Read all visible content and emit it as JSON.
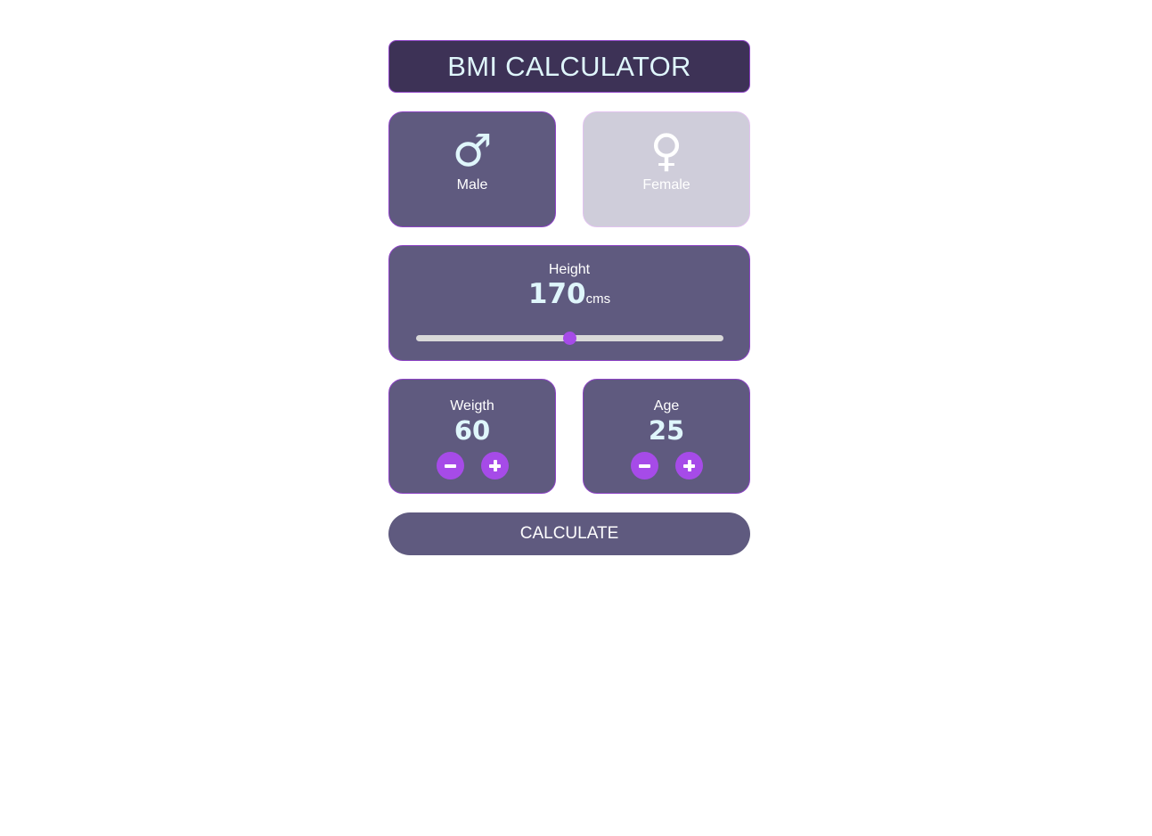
{
  "header": {
    "title": "BMI CALCULATOR"
  },
  "gender": {
    "male": {
      "label": "Male",
      "icon": "male-icon",
      "symbol": "♂",
      "selected": true
    },
    "female": {
      "label": "Female",
      "icon": "female-icon",
      "symbol": "♀",
      "selected": false
    }
  },
  "height": {
    "label": "Height",
    "value": "170",
    "unit": "cms",
    "slider_fraction": 0.5
  },
  "weight": {
    "label": "Weigth",
    "value": "60",
    "decrement_icon": "minus-icon",
    "increment_icon": "plus-icon"
  },
  "age": {
    "label": "Age",
    "value": "25",
    "decrement_icon": "minus-icon",
    "increment_icon": "plus-icon"
  },
  "actions": {
    "calculate_label": "CALCULATE"
  },
  "colors": {
    "title_bg": "#3d3256",
    "card_bg": "#5f5a7f",
    "inactive_card_bg": "#cfcdda",
    "accent": "#a64be8",
    "value_text": "#dff6fb"
  }
}
